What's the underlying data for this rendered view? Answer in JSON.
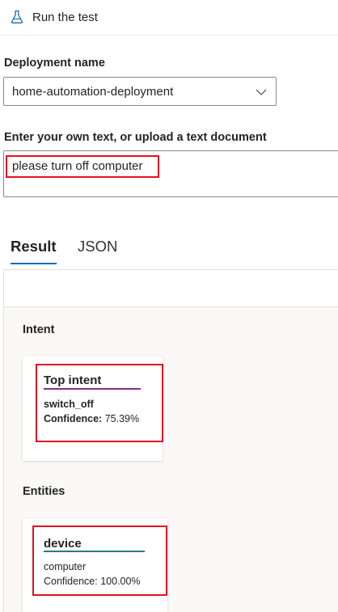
{
  "toolbar": {
    "run_label": "Run the test",
    "run_icon": "flask-icon"
  },
  "deployment": {
    "label": "Deployment name",
    "selected": "home-automation-deployment"
  },
  "input": {
    "label": "Enter your own text, or upload a text document",
    "value": "please turn off computer"
  },
  "tabs": [
    {
      "label": "Result",
      "selected": true
    },
    {
      "label": "JSON",
      "selected": false
    }
  ],
  "result": {
    "intent_section": "Intent",
    "top_intent": {
      "title": "Top intent",
      "name": "switch_off",
      "confidence_label": "Confidence:",
      "confidence_value": "75.39%"
    },
    "entities_section": "Entities",
    "entity": {
      "title": "device",
      "text": "computer",
      "confidence_label": "Confidence:",
      "confidence_value": "100.00%"
    }
  },
  "colors": {
    "accent": "#0f6cbd",
    "intent_underline": "#8a2b8c",
    "entity_underline": "#2b7a82",
    "highlight": "#e0121f"
  }
}
